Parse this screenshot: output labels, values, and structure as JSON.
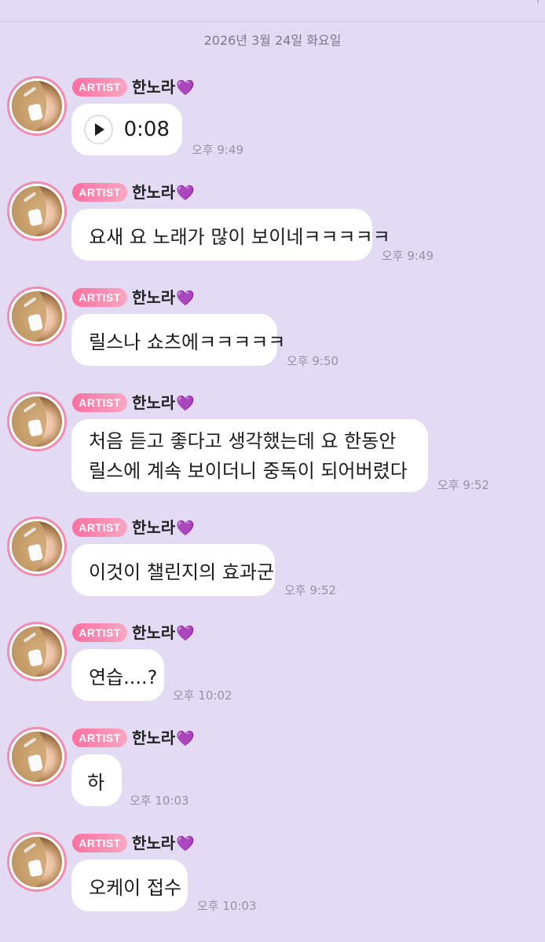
{
  "date_separator": "2026년 3월 24일 화요일",
  "sender": {
    "badge": "ARTIST",
    "name": "한노라",
    "name_emoji": "💜"
  },
  "messages": [
    {
      "type": "voice",
      "duration": "0:08",
      "time": "오후 9:49"
    },
    {
      "type": "text",
      "lines": [
        "요새 요 노래가 많이 보이네ㅋㅋㅋㅋㅋ"
      ],
      "time": "오후 9:49"
    },
    {
      "type": "text",
      "lines": [
        "릴스나 쇼츠에ㅋㅋㅋㅋㅋ"
      ],
      "time": "오후 9:50"
    },
    {
      "type": "text",
      "lines": [
        "처음 듣고 좋다고 생각했는데 요 한동안",
        "릴스에 계속 보이더니 중독이 되어버렸다"
      ],
      "time": "오후 9:52"
    },
    {
      "type": "text",
      "lines": [
        "이것이 챌린지의 효과군"
      ],
      "time": "오후 9:52"
    },
    {
      "type": "text",
      "lines": [
        "연습....?"
      ],
      "time": "오후 10:02"
    },
    {
      "type": "text",
      "lines": [
        "하"
      ],
      "time": "오후 10:03"
    },
    {
      "type": "text",
      "lines": [
        "오케이 접수"
      ],
      "time": "오후 10:03"
    }
  ],
  "colors": {
    "background": "#e3dbf3",
    "badge": "#ff6fa0",
    "avatar_ring": "#f08db1",
    "heart": "#9b4be6"
  },
  "icons": {
    "play": "play-icon",
    "heart": "purple-heart-emoji",
    "avatar": "artist-avatar"
  }
}
